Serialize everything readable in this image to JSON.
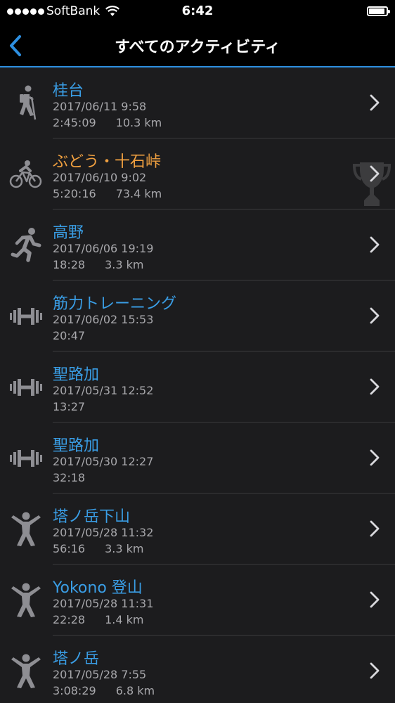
{
  "status_bar": {
    "carrier": "SoftBank",
    "time": "6:42",
    "signal_bars": 5
  },
  "nav": {
    "back_icon": "chevron-left-icon",
    "title": "すべてのアクティビティ",
    "accent_color": "#2d8fe0"
  },
  "activities": [
    {
      "icon": "hiking-icon",
      "title": "桂台",
      "date": "2017/06/11 9:58",
      "duration": "2:45:09",
      "distance": "10.3 km",
      "highlight": false,
      "trophy": false
    },
    {
      "icon": "cycling-icon",
      "title": "ぶどう・十石峠",
      "date": "2017/06/10 9:02",
      "duration": "5:20:16",
      "distance": "73.4 km",
      "highlight": true,
      "trophy": true
    },
    {
      "icon": "running-icon",
      "title": "高野",
      "date": "2017/06/06 19:19",
      "duration": "18:28",
      "distance": "3.3 km",
      "highlight": false,
      "trophy": false
    },
    {
      "icon": "strength-icon",
      "title": "筋力トレーニング",
      "date": "2017/06/02 15:53",
      "duration": "20:47",
      "distance": "",
      "highlight": false,
      "trophy": false
    },
    {
      "icon": "strength-icon",
      "title": "聖路加",
      "date": "2017/05/31 12:52",
      "duration": "13:27",
      "distance": "",
      "highlight": false,
      "trophy": false
    },
    {
      "icon": "strength-icon",
      "title": "聖路加",
      "date": "2017/05/30 12:27",
      "duration": "32:18",
      "distance": "",
      "highlight": false,
      "trophy": false
    },
    {
      "icon": "other-activity-icon",
      "title": "塔ノ岳下山",
      "date": "2017/05/28 11:32",
      "duration": "56:16",
      "distance": "3.3 km",
      "highlight": false,
      "trophy": false
    },
    {
      "icon": "other-activity-icon",
      "title": "Yokono 登山",
      "date": "2017/05/28 11:31",
      "duration": "22:28",
      "distance": "1.4 km",
      "highlight": false,
      "trophy": false
    },
    {
      "icon": "other-activity-icon",
      "title": "塔ノ岳",
      "date": "2017/05/28 7:55",
      "duration": "3:08:29",
      "distance": "6.8 km",
      "highlight": false,
      "trophy": false
    }
  ],
  "colors": {
    "title_blue": "#3a9ee6",
    "title_orange": "#f0a040",
    "meta_gray": "#a8a8ac",
    "icon_gray": "#8e8e93"
  }
}
